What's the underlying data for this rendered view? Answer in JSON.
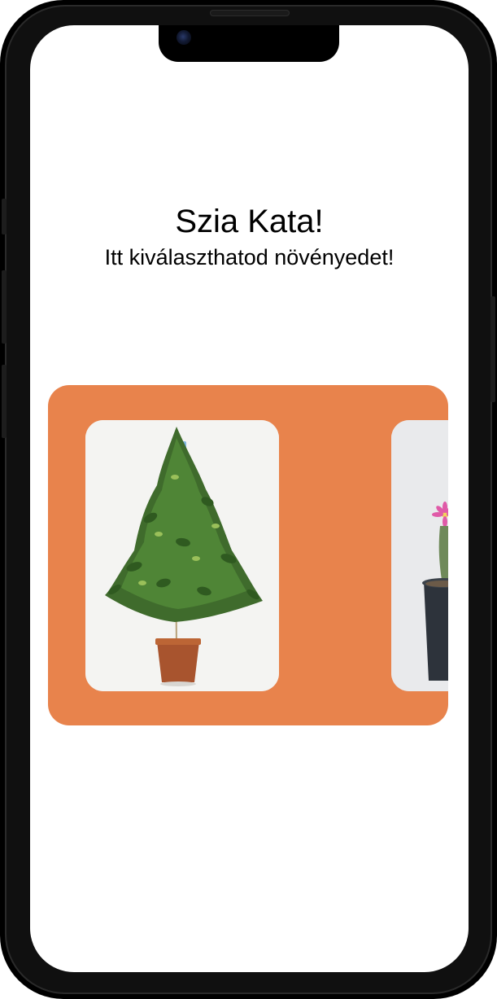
{
  "greeting": {
    "title": "Szia Kata!",
    "subtitle": "Itt kiválaszthatod növényedet!"
  },
  "carousel": {
    "accent_color": "#e8834c",
    "cards": [
      {
        "icon": "ficus-plant-image"
      },
      {
        "icon": "flowering-cactus-image"
      }
    ]
  }
}
